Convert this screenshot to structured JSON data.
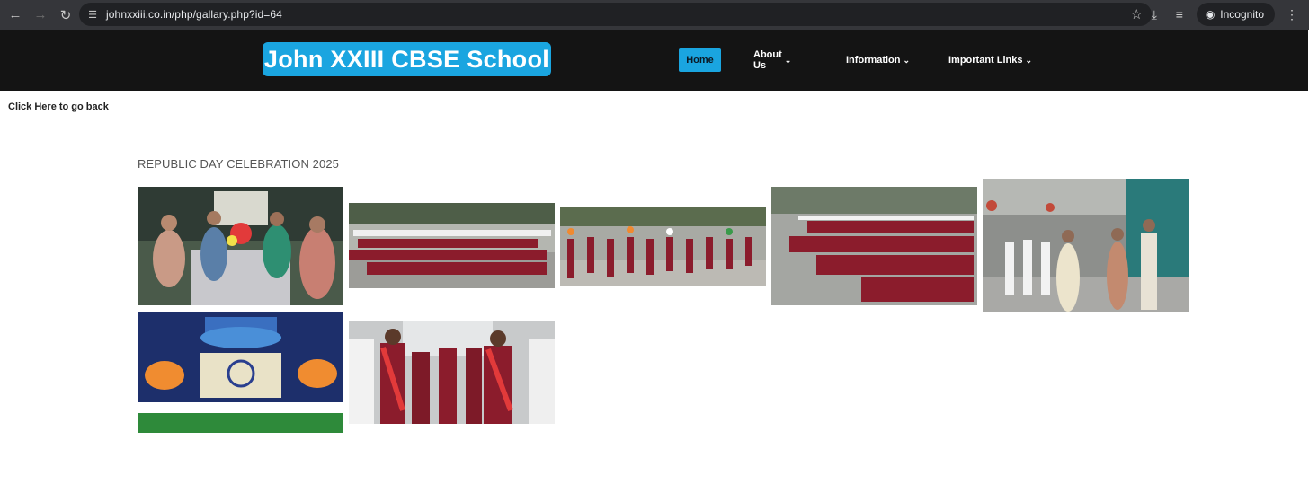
{
  "browser": {
    "url": "johnxxiii.co.in/php/gallary.php?id=64",
    "profile_label": "Incognito",
    "icons": [
      "back-icon",
      "forward-icon",
      "reload-icon",
      "site-info-icon",
      "bookmark-star-icon",
      "download-icon",
      "reading-list-icon",
      "incognito-icon",
      "kebab-menu-icon"
    ]
  },
  "header": {
    "logo_text": "John XXIII CBSE School",
    "menu": {
      "home": "Home",
      "about": "About Us",
      "information": "Information",
      "important_links": "Important Links"
    }
  },
  "page": {
    "back_link": "Click Here to go back",
    "gallery_title": "REPUBLIC DAY CELEBRATION 2025"
  },
  "colors": {
    "brand_blue": "#1aa5e0",
    "header_bg": "#141414",
    "uniform_maroon": "#8b1c2c"
  }
}
